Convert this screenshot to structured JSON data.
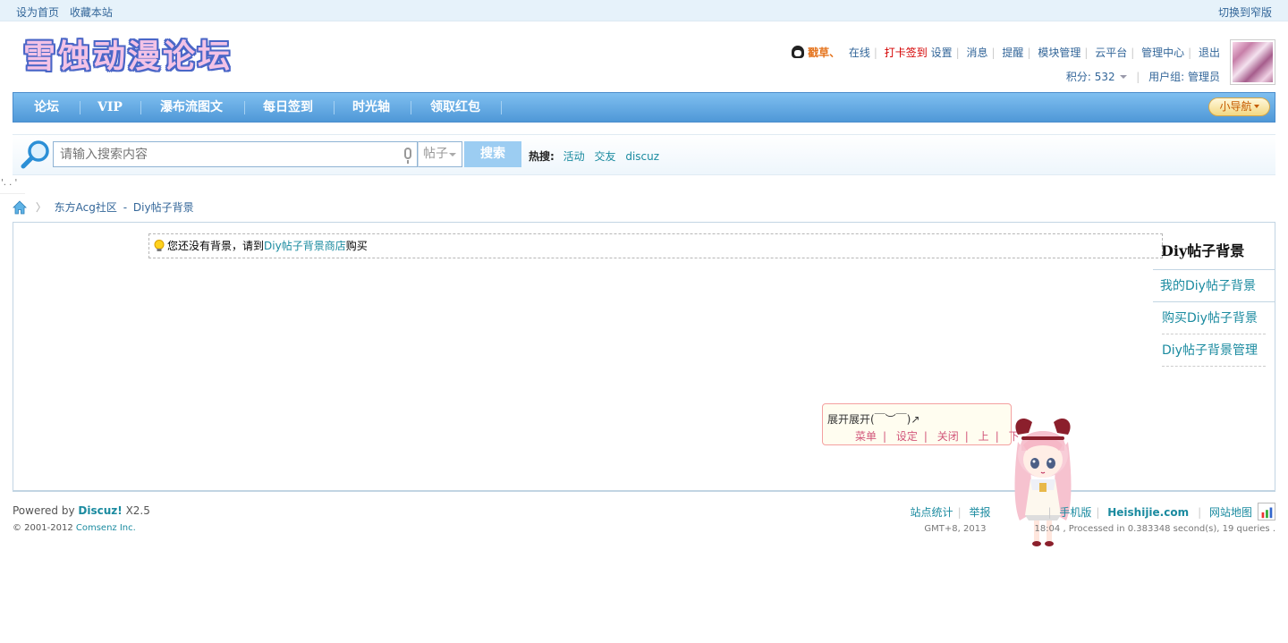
{
  "topbar": {
    "set_home": "设为首页",
    "bookmark": "收藏本站",
    "switch_width": "切换到窄版"
  },
  "header": {
    "logo_text": "雪蚀动漫论坛",
    "username": "戳草、",
    "online": "在线",
    "signin": "打卡签到",
    "links": [
      "设置",
      "消息",
      "提醒",
      "模块管理",
      "云平台",
      "管理中心",
      "退出"
    ],
    "points": "积分: 532",
    "usergroup": "用户组: 管理员"
  },
  "nav": {
    "items": [
      "论坛",
      "VIP",
      "瀑布流图文",
      "每日签到",
      "时光轴",
      "领取红包"
    ],
    "mini_nav": "小导航"
  },
  "search": {
    "placeholder": "请输入搜索内容",
    "type": "帖子",
    "button": "搜索",
    "hot_label": "热搜:",
    "hot_terms": [
      "活动",
      "交友",
      "discuz"
    ]
  },
  "odd_text": "'. . '",
  "breadcrumb": {
    "site": "东方Acg社区",
    "sep": "-",
    "page": "Diy帖子背景"
  },
  "notice": {
    "prefix": "您还没有背景，请到",
    "link": "Diy帖子背景商店",
    "suffix": "购买"
  },
  "sidebar": {
    "title": "Diy帖子背景",
    "links": [
      "我的Diy帖子背景",
      "购买Diy帖子背景",
      "Diy帖子背景管理"
    ]
  },
  "pet": {
    "message": "展开展开(￣︶￣)↗",
    "menu": [
      "菜单",
      "设定",
      "关闭",
      "上",
      "下"
    ]
  },
  "footer": {
    "powered": "Powered by",
    "discuz": "Discuz!",
    "version": "X2.5",
    "copyright_prefix": "© 2001-2012",
    "copyright_link": "Comsenz Inc.",
    "links": [
      "站点统计",
      "举报",
      "手机版"
    ],
    "domain": "Heishijie.com",
    "sitemap": "网站地图",
    "time_prefix": "GMT+8, 2013",
    "time_suffix": "18:04 , Processed in 0.383348 second(s), 19 queries ."
  }
}
